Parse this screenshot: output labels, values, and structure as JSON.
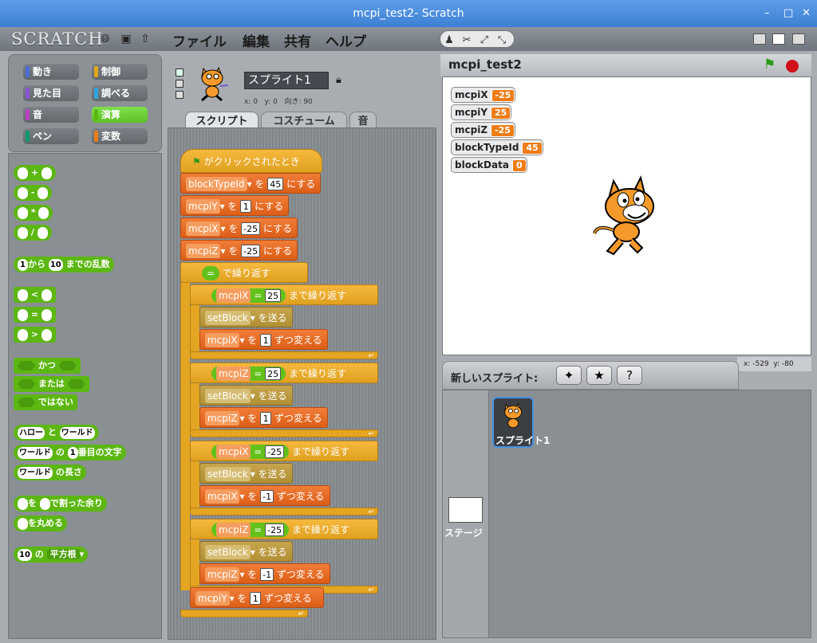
{
  "window": {
    "title": "mcpi_test2- Scratch",
    "min": "–",
    "max": "□",
    "close": "✕"
  },
  "menubar": {
    "logo": "SCRATCH",
    "menus": [
      "ファイル",
      "編集",
      "共有",
      "ヘルプ"
    ]
  },
  "categories": [
    {
      "label": "動き",
      "color": "#4a6cd4"
    },
    {
      "label": "制御",
      "color": "#e1a91a"
    },
    {
      "label": "見た目",
      "color": "#8a55d7"
    },
    {
      "label": "調べる",
      "color": "#2ca5e2"
    },
    {
      "label": "音",
      "color": "#bb42c3"
    },
    {
      "label": "演算",
      "color": "#5cb712"
    },
    {
      "label": "ペン",
      "color": "#0e9a6c"
    },
    {
      "label": "変数",
      "color": "#ee7d16"
    }
  ],
  "palette": {
    "ops": [
      "+",
      "-",
      "*",
      "/"
    ],
    "random": {
      "a": "1",
      "mid": "から",
      "b": "10",
      "end": "までの乱数"
    },
    "compare": [
      "<",
      "=",
      ">"
    ],
    "logic": [
      "かつ",
      "または",
      "ではない"
    ],
    "join": {
      "a": "ハロー",
      "mid": "と",
      "b": "ワールド"
    },
    "letter": {
      "a": "ワールド",
      "mid": "の",
      "n": "1",
      "end": "番目の文字"
    },
    "length": {
      "a": "ワールド",
      "end": "の長さ"
    },
    "mod": {
      "mid": "を",
      "end": "で割った余り"
    },
    "round": {
      "end": "を丸める"
    },
    "sqrt": {
      "n": "10",
      "mid": "の",
      "fn": "平方根"
    }
  },
  "sprite": {
    "name": "スプライト1",
    "x_label": "x: 0",
    "y_label": "y: 0",
    "dir_label": "向き: 90"
  },
  "tabs": [
    "スクリプト",
    "コスチューム",
    "音"
  ],
  "script": {
    "hat": "がクリックされたとき",
    "set1": {
      "var": "blockTypeId",
      "to": "を",
      "val": "45",
      "end": "にする"
    },
    "set2": {
      "var": "mcpiY",
      "to": "を",
      "val": "1",
      "end": "にする"
    },
    "set3": {
      "var": "mcpiX",
      "to": "を",
      "val": "-25",
      "end": "にする"
    },
    "set4": {
      "var": "mcpiZ",
      "to": "を",
      "val": "-25",
      "end": "にする"
    },
    "outer_until": "で繰り返す",
    "outer_eq": "=",
    "loops": [
      {
        "var": "mcpiX",
        "val": "25",
        "until": "まで繰り返す",
        "send": "setBlock",
        "send_label": "を送る",
        "change_var": "mcpiX",
        "change_by": "1",
        "change_label": "ずつ変える"
      },
      {
        "var": "mcpiZ",
        "val": "25",
        "until": "まで繰り返す",
        "send": "setBlock",
        "send_label": "を送る",
        "change_var": "mcpiZ",
        "change_by": "1",
        "change_label": "ずつ変える"
      },
      {
        "var": "mcpiX",
        "val": "-25",
        "until": "まで繰り返す",
        "send": "setBlock",
        "send_label": "を送る",
        "change_var": "mcpiX",
        "change_by": "-1",
        "change_label": "ずつ変える"
      },
      {
        "var": "mcpiZ",
        "val": "-25",
        "until": "まで繰り返す",
        "send": "setBlock",
        "send_label": "を送る",
        "change_var": "mcpiZ",
        "change_by": "-1",
        "change_label": "ずつ変える"
      }
    ],
    "final": {
      "var": "mcpiY",
      "to": "を",
      "val": "1",
      "end": "ずつ変える"
    }
  },
  "stage": {
    "title": "mcpi_test2",
    "monitors": [
      {
        "name": "mcpiX",
        "value": "-25"
      },
      {
        "name": "mcpiY",
        "value": "25"
      },
      {
        "name": "mcpiZ",
        "value": "-25"
      },
      {
        "name": "blockTypeId",
        "value": "45"
      },
      {
        "name": "blockData",
        "value": "0"
      }
    ],
    "mouse_x": "x: -529",
    "mouse_y": "y: -80"
  },
  "sprites_pane": {
    "new_sprite_label": "新しいスプライト:",
    "stage_label": "ステージ",
    "sprite_thumb_label": "スプライト1"
  }
}
